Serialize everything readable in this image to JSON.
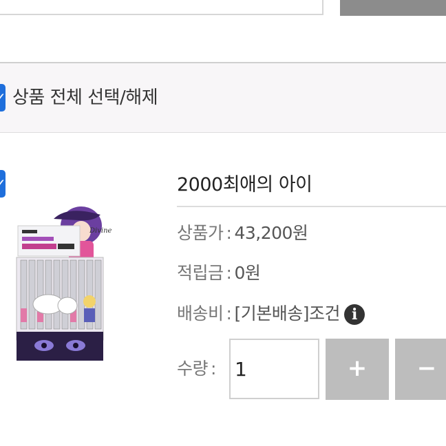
{
  "select_all": {
    "label": "상품 전체 선택/해제"
  },
  "product": {
    "name": "2000최애의 아이",
    "price_label": "상품가",
    "price_value": "43,200원",
    "points_label": "적립금",
    "points_value": "0원",
    "shipping_label": "배송비",
    "shipping_value": "[기본배송]조건",
    "info_icon": "i",
    "quantity_label": "수량",
    "quantity_value": "1",
    "separator": ":"
  },
  "buttons": {
    "plus": "+",
    "minus": "−"
  },
  "icons": {
    "check": "✓"
  },
  "colors": {
    "accent": "#1f6fdc",
    "qty_button": "#bdbdbd",
    "top_button": "#8c8c8c",
    "bar_bg": "#f8f6f8"
  }
}
